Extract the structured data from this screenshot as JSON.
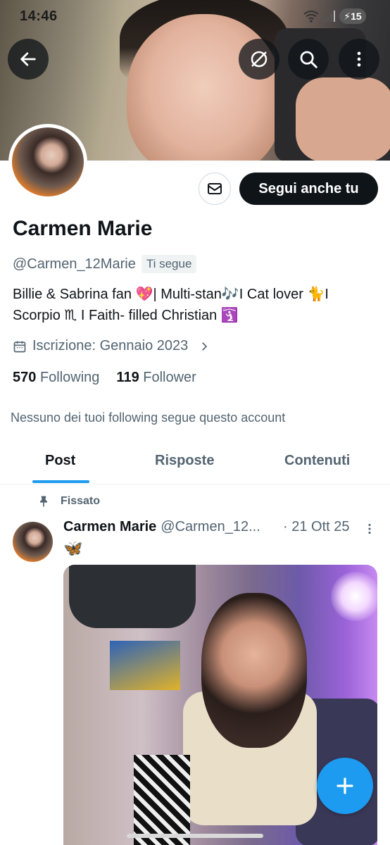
{
  "status_bar": {
    "time": "14:46",
    "wifi_label": "6",
    "battery": "15"
  },
  "header": {
    "back_icon": "arrow-left-icon",
    "translate_icon": "globe-strike-icon",
    "search_icon": "search-icon",
    "more_icon": "more-vertical-icon"
  },
  "profile": {
    "name": "Carmen Marie",
    "handle": "@Carmen_12Marie",
    "follows_you": "Ti segue",
    "bio_line1": "Billie & Sabrina fan 💖| Multi-stan🎶I Cat lover 🐈I",
    "bio_line2": "Scorpio ♏ I Faith- filled Christian 🛐",
    "joined": "Iscrizione: Gennaio 2023",
    "following_count": "570",
    "following_label": "Following",
    "followers_count": "119",
    "followers_label": "Follower",
    "no_mutuals": "Nessuno dei tuoi following segue questo account",
    "follow_button": "Segui anche tu",
    "message_icon": "mail-icon"
  },
  "tabs": [
    {
      "label": "Post",
      "active": true
    },
    {
      "label": "Risposte",
      "active": false
    },
    {
      "label": "Contenuti",
      "active": false
    }
  ],
  "post": {
    "pinned_label": "Fissato",
    "author": "Carmen Marie",
    "handle": "@Carmen_12...",
    "date": "· 21 Ott 25",
    "text": "🦋"
  },
  "fab_icon": "plus-icon",
  "colors": {
    "accent": "#1d9bf0",
    "text": "#0f1419",
    "secondary": "#536471"
  }
}
